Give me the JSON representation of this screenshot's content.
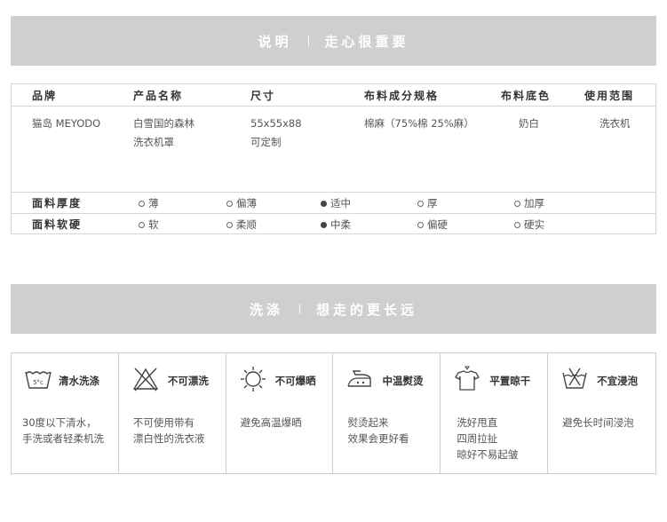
{
  "banner1": {
    "left": "说明",
    "right": "走心很重要"
  },
  "banner2": {
    "left": "洗涤",
    "right": "想走的更长远"
  },
  "table": {
    "headers": [
      "品牌",
      "产品名称",
      "尺寸",
      "布料成分规格",
      "布料底色",
      "使用范围"
    ],
    "brand": "猫岛 MEYODO",
    "product": [
      "白雪国的森林",
      "洗衣机罩"
    ],
    "size": [
      "55x55x88",
      "可定制"
    ],
    "fabric": "棉麻（75%棉  25%麻）",
    "color": "奶白",
    "usage": "洗衣机",
    "thickness": {
      "label": "面料厚度",
      "options": [
        "薄",
        "偏薄",
        "适中",
        "厚",
        "加厚"
      ],
      "selected": "适中"
    },
    "softness": {
      "label": "面料软硬",
      "options": [
        "软",
        "柔顺",
        "中柔",
        "偏硬",
        "硬实"
      ],
      "selected": "中柔"
    }
  },
  "care": [
    {
      "icon": "wash-tub-icon",
      "title": "清水洗涤",
      "desc": [
        "30度以下清水，",
        "手洗或者轻柔机洗"
      ],
      "temp": "5°c"
    },
    {
      "icon": "no-bleach-icon",
      "title": "不可漂洗",
      "desc": [
        "不可使用带有",
        "漂白性的洗衣液"
      ]
    },
    {
      "icon": "no-sun-icon",
      "title": "不可爆晒",
      "desc": [
        "避免高温爆晒"
      ]
    },
    {
      "icon": "iron-icon",
      "title": "中温熨烫",
      "desc": [
        "熨烫起来",
        "效果会更好看"
      ]
    },
    {
      "icon": "flat-dry-icon",
      "title": "平置晾干",
      "desc": [
        "洗好甩直",
        "四周拉扯",
        "晾好不易起皱"
      ]
    },
    {
      "icon": "no-soak-icon",
      "title": "不宜浸泡",
      "desc": [
        "避免长时间浸泡"
      ]
    }
  ]
}
